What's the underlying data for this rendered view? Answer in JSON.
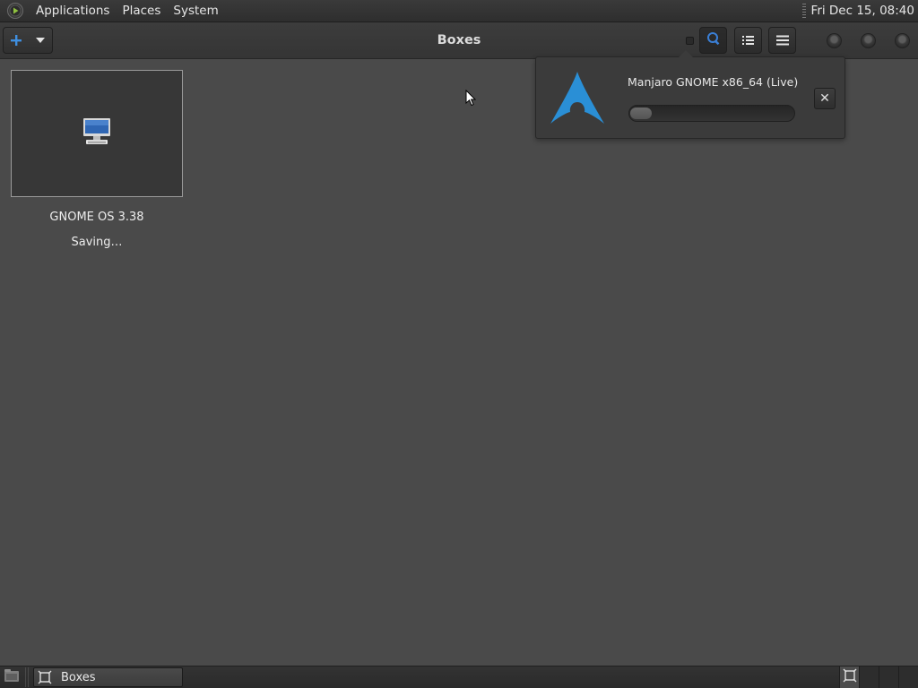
{
  "top_panel": {
    "menus": [
      "Applications",
      "Places",
      "System"
    ],
    "clock": "Fri Dec 15, 08:40"
  },
  "headerbar": {
    "title": "Boxes",
    "new_button_icon": "plus-icon",
    "buttons": [
      "search-icon",
      "list-view-icon",
      "menu-icon"
    ]
  },
  "boxes": [
    {
      "name": "GNOME OS 3.38",
      "status": "Saving…",
      "icon": "computer-icon"
    }
  ],
  "download_popover": {
    "title": "Manjaro GNOME x86_64 (Live)",
    "progress": 0.1,
    "close_icon": "close-icon"
  },
  "taskbar": {
    "tasks": [
      {
        "label": "Boxes"
      }
    ]
  },
  "colors": {
    "accent": "#2a8fd6",
    "background": "#4a4a4a",
    "panel": "#2e2e2e"
  }
}
